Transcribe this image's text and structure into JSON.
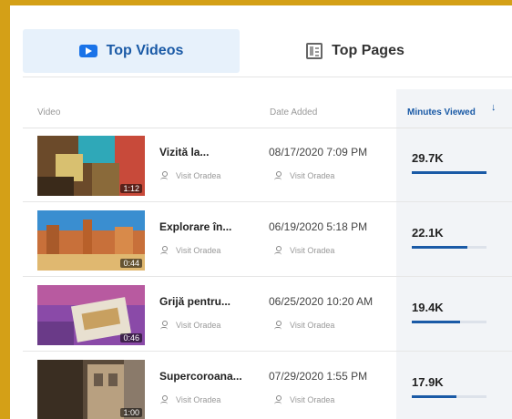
{
  "tabs": {
    "top_videos": "Top Videos",
    "top_pages": "Top Pages"
  },
  "columns": {
    "video": "Video",
    "date_added": "Date Added",
    "minutes_viewed": "Minutes Viewed"
  },
  "rows": [
    {
      "title": "Vizită la...",
      "channel": "Visit Oradea",
      "date": "08/17/2020 7:09 PM",
      "minutes": "29.7K",
      "fraction": 1.0,
      "duration": "1:12"
    },
    {
      "title": "Explorare în...",
      "channel": "Visit Oradea",
      "date": "06/19/2020 5:18 PM",
      "minutes": "22.1K",
      "fraction": 0.74,
      "duration": "0:44"
    },
    {
      "title": "Grijă pentru...",
      "channel": "Visit Oradea",
      "date": "06/25/2020 10:20 AM",
      "minutes": "19.4K",
      "fraction": 0.65,
      "duration": "0:46"
    },
    {
      "title": "Supercoroana...",
      "channel": "Visit Oradea",
      "date": "07/29/2020 1:55 PM",
      "minutes": "17.9K",
      "fraction": 0.6,
      "duration": "1:00"
    }
  ],
  "colors": {
    "accent": "#1a5aa6",
    "active_tab_bg": "#e7f1fb"
  }
}
